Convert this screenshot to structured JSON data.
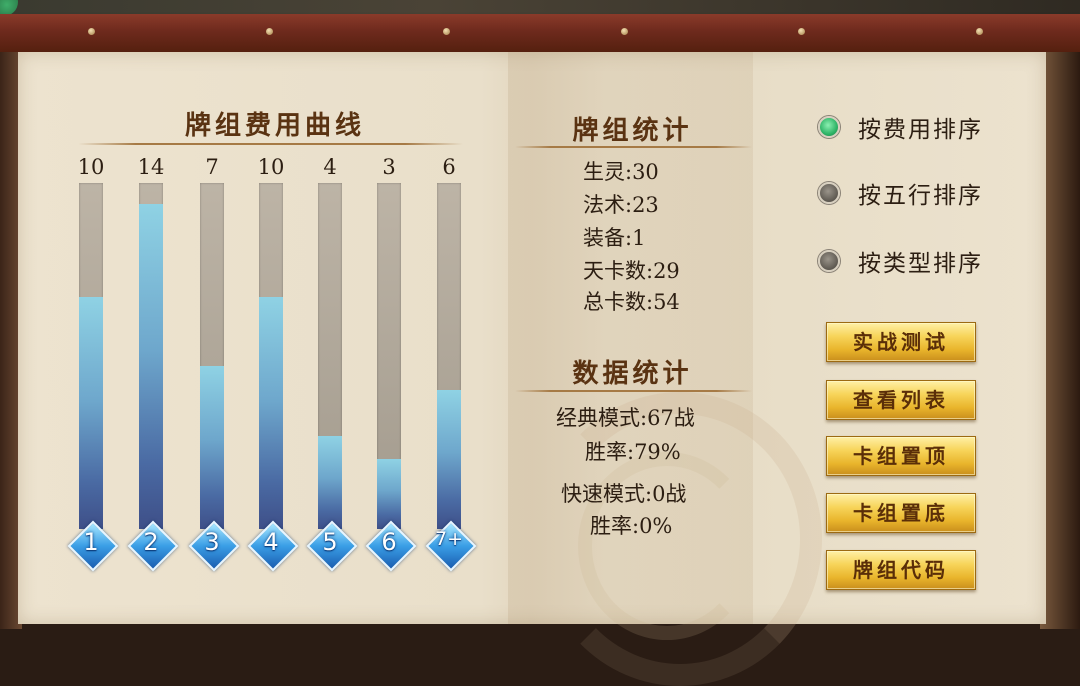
{
  "curve": {
    "title": "牌组费用曲线",
    "max": 14,
    "bars": [
      {
        "count": "10",
        "label": "1",
        "value": 10
      },
      {
        "count": "14",
        "label": "2",
        "value": 14
      },
      {
        "count": "7",
        "label": "3",
        "value": 7
      },
      {
        "count": "10",
        "label": "4",
        "value": 10
      },
      {
        "count": "4",
        "label": "5",
        "value": 4
      },
      {
        "count": "3",
        "label": "6",
        "value": 3
      },
      {
        "count": "6",
        "label": "7+",
        "value": 6
      }
    ]
  },
  "deck_stats": {
    "title": "牌组统计",
    "items": [
      "生灵:30",
      "法术:23",
      "装备:1",
      "天卡数:29",
      "总卡数:54"
    ]
  },
  "data_stats": {
    "title": "数据统计",
    "classic": "经典模式:67战",
    "classic_rate": "胜率:79%",
    "quick": "快速模式:0战",
    "quick_rate": "胜率:0%"
  },
  "sort": {
    "selected": 0,
    "options": [
      "按费用排序",
      "按五行排序",
      "按类型排序"
    ]
  },
  "buttons": [
    "实战测试",
    "查看列表",
    "卡组置顶",
    "卡组置底",
    "牌组代码"
  ],
  "colors": {
    "title": "#5a3312",
    "parchment": "#ece2ce",
    "bar_fill_top": "#8fd2e4",
    "bar_fill_bottom": "#3e4f88",
    "radio_on": "#2fb467",
    "button_gold": "#f7d45a"
  }
}
